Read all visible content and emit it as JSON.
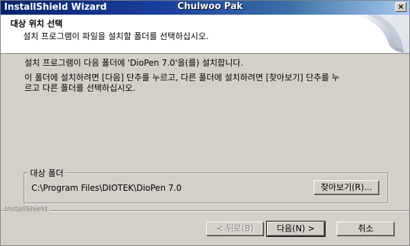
{
  "window": {
    "title": "InstallShield Wizard",
    "user_label": "Chulwoo Pak",
    "close_glyph": "×"
  },
  "header": {
    "title": "대상 위치 선택",
    "subtitle": "설치 프로그램이 파일을 설치할 폴더를 선택하십시오."
  },
  "body": {
    "line1": "설치 프로그램이 다음 폴더에 'DioPen 7.0'을(를) 설치합니다.",
    "line2": "이 폴더에 설치하려면 [다음] 단추를 누르고, 다른 폴더에 설치하려면 [찾아보기] 단추를 누",
    "line3": "르고 다른 폴더를 선택하십시오."
  },
  "destination": {
    "group_label": "대상 폴더",
    "path": "C:\\Program Files\\DIOTEK\\DioPen 7.0",
    "browse_label": "찾아보기(R)..."
  },
  "footer": {
    "brand": "InstallShield",
    "back_label": "< 뒤로(B)",
    "next_label": "다음(N) >",
    "cancel_label": "취소"
  },
  "colors": {
    "titlebar_start": "#0a246a",
    "titlebar_end": "#a6caf0",
    "face": "#d4d0c8"
  }
}
